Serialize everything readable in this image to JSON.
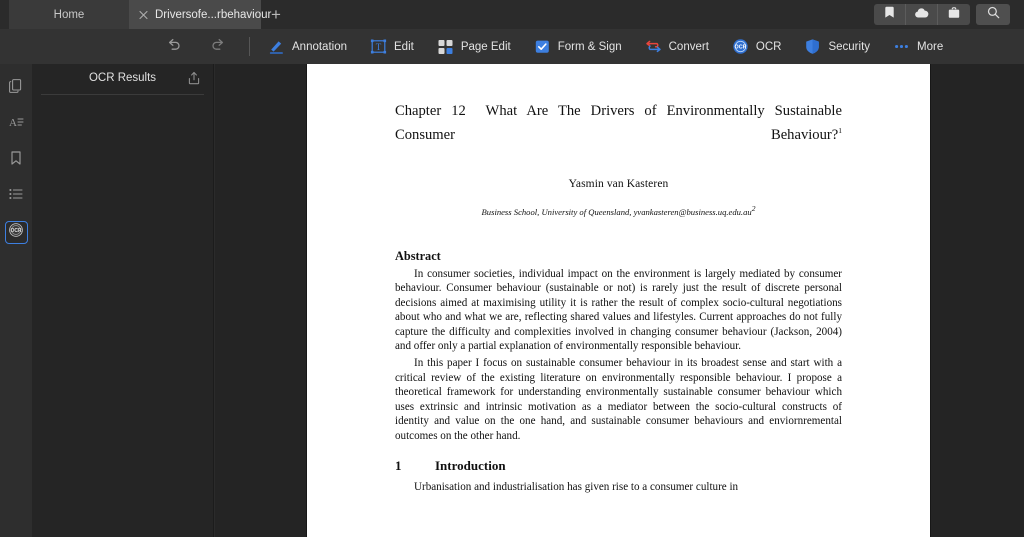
{
  "window": {
    "tabs": [
      {
        "label": "Home",
        "active": false,
        "closable": false
      },
      {
        "label": "Driversofe...rbehaviour",
        "active": true,
        "closable": true
      }
    ],
    "new_tab_label": "+",
    "controls": [
      {
        "name": "tag-icon",
        "label": "Tag"
      },
      {
        "name": "cloud-icon",
        "label": "Cloud"
      },
      {
        "name": "briefcase-icon",
        "label": "Briefcase"
      }
    ],
    "search_label": "Search"
  },
  "toolbar": {
    "undo_label": "Undo",
    "redo_label": "Redo",
    "items": [
      {
        "label": "Annotation",
        "icon": "pen-icon"
      },
      {
        "label": "Edit",
        "icon": "text-edit-icon"
      },
      {
        "label": "Page Edit",
        "icon": "grid-icon"
      },
      {
        "label": "Form & Sign",
        "icon": "checkbox-icon"
      },
      {
        "label": "Convert",
        "icon": "convert-icon"
      },
      {
        "label": "OCR",
        "icon": "ocr-icon"
      },
      {
        "label": "Security",
        "icon": "shield-icon"
      },
      {
        "label": "More",
        "icon": "ellipsis-icon"
      }
    ]
  },
  "rail": {
    "items": [
      {
        "name": "thumbnails",
        "icon": "pages-icon",
        "selected": false
      },
      {
        "name": "text",
        "icon": "text-lines-icon",
        "selected": false
      },
      {
        "name": "bookmarks",
        "icon": "bookmark-icon",
        "selected": false
      },
      {
        "name": "outline",
        "icon": "list-icon",
        "selected": false
      },
      {
        "name": "ocr",
        "icon": "ocr-icon",
        "selected": true
      }
    ]
  },
  "panel": {
    "title": "OCR Results",
    "export_label": "Export",
    "body_text": ""
  },
  "document": {
    "chapter_number": "Chapter 12",
    "title": "What Are The Drivers of Environmentally Sustainable Consumer Behaviour?",
    "title_footnote": "1",
    "author": "Yasmin van Kasteren",
    "affiliation": "Business School, University of Queensland, yvankasteren@business.uq.edu.au",
    "affiliation_footnote": "2",
    "abstract_heading": "Abstract",
    "abstract_paragraph_1": "In consumer societies, individual impact on the environment is largely mediated by consumer behaviour. Consumer behaviour (sustainable or not) is rarely just the result of discrete personal decisions aimed at maximising utility it is rather the result of complex socio-cultural negotiations about who and what we are, reflecting shared values and lifestyles. Current approaches do not fully capture the difficulty and complexities involved in changing consumer behaviour (Jackson, 2004) and offer only a partial explanation of environmentally responsible behaviour.",
    "abstract_paragraph_2": "In this paper I focus on sustainable consumer behaviour in its broadest sense and start with a critical review of the existing literature on environmentally responsible behaviour. I propose a theoretical framework for understanding environmentally sustainable consumer behaviour which uses extrinsic and intrinsic motivation as a mediator between the socio-cultural constructs of identity and value on the one hand, and sustainable consumer behaviours and enviornremental outcomes on the other hand.",
    "section_number": "1",
    "section_title": "Introduction",
    "section_paragraph_1": "Urbanisation and industrialisation has given rise to a consumer culture in"
  },
  "colors": {
    "window_bg": "#2b2b2b",
    "toolbar_bg": "#333333",
    "panel_bg": "#252525",
    "viewport_bg": "#242424",
    "accent_blue": "#3d7fe0",
    "convert_red": "#e8453c",
    "page_white": "#ffffff"
  }
}
